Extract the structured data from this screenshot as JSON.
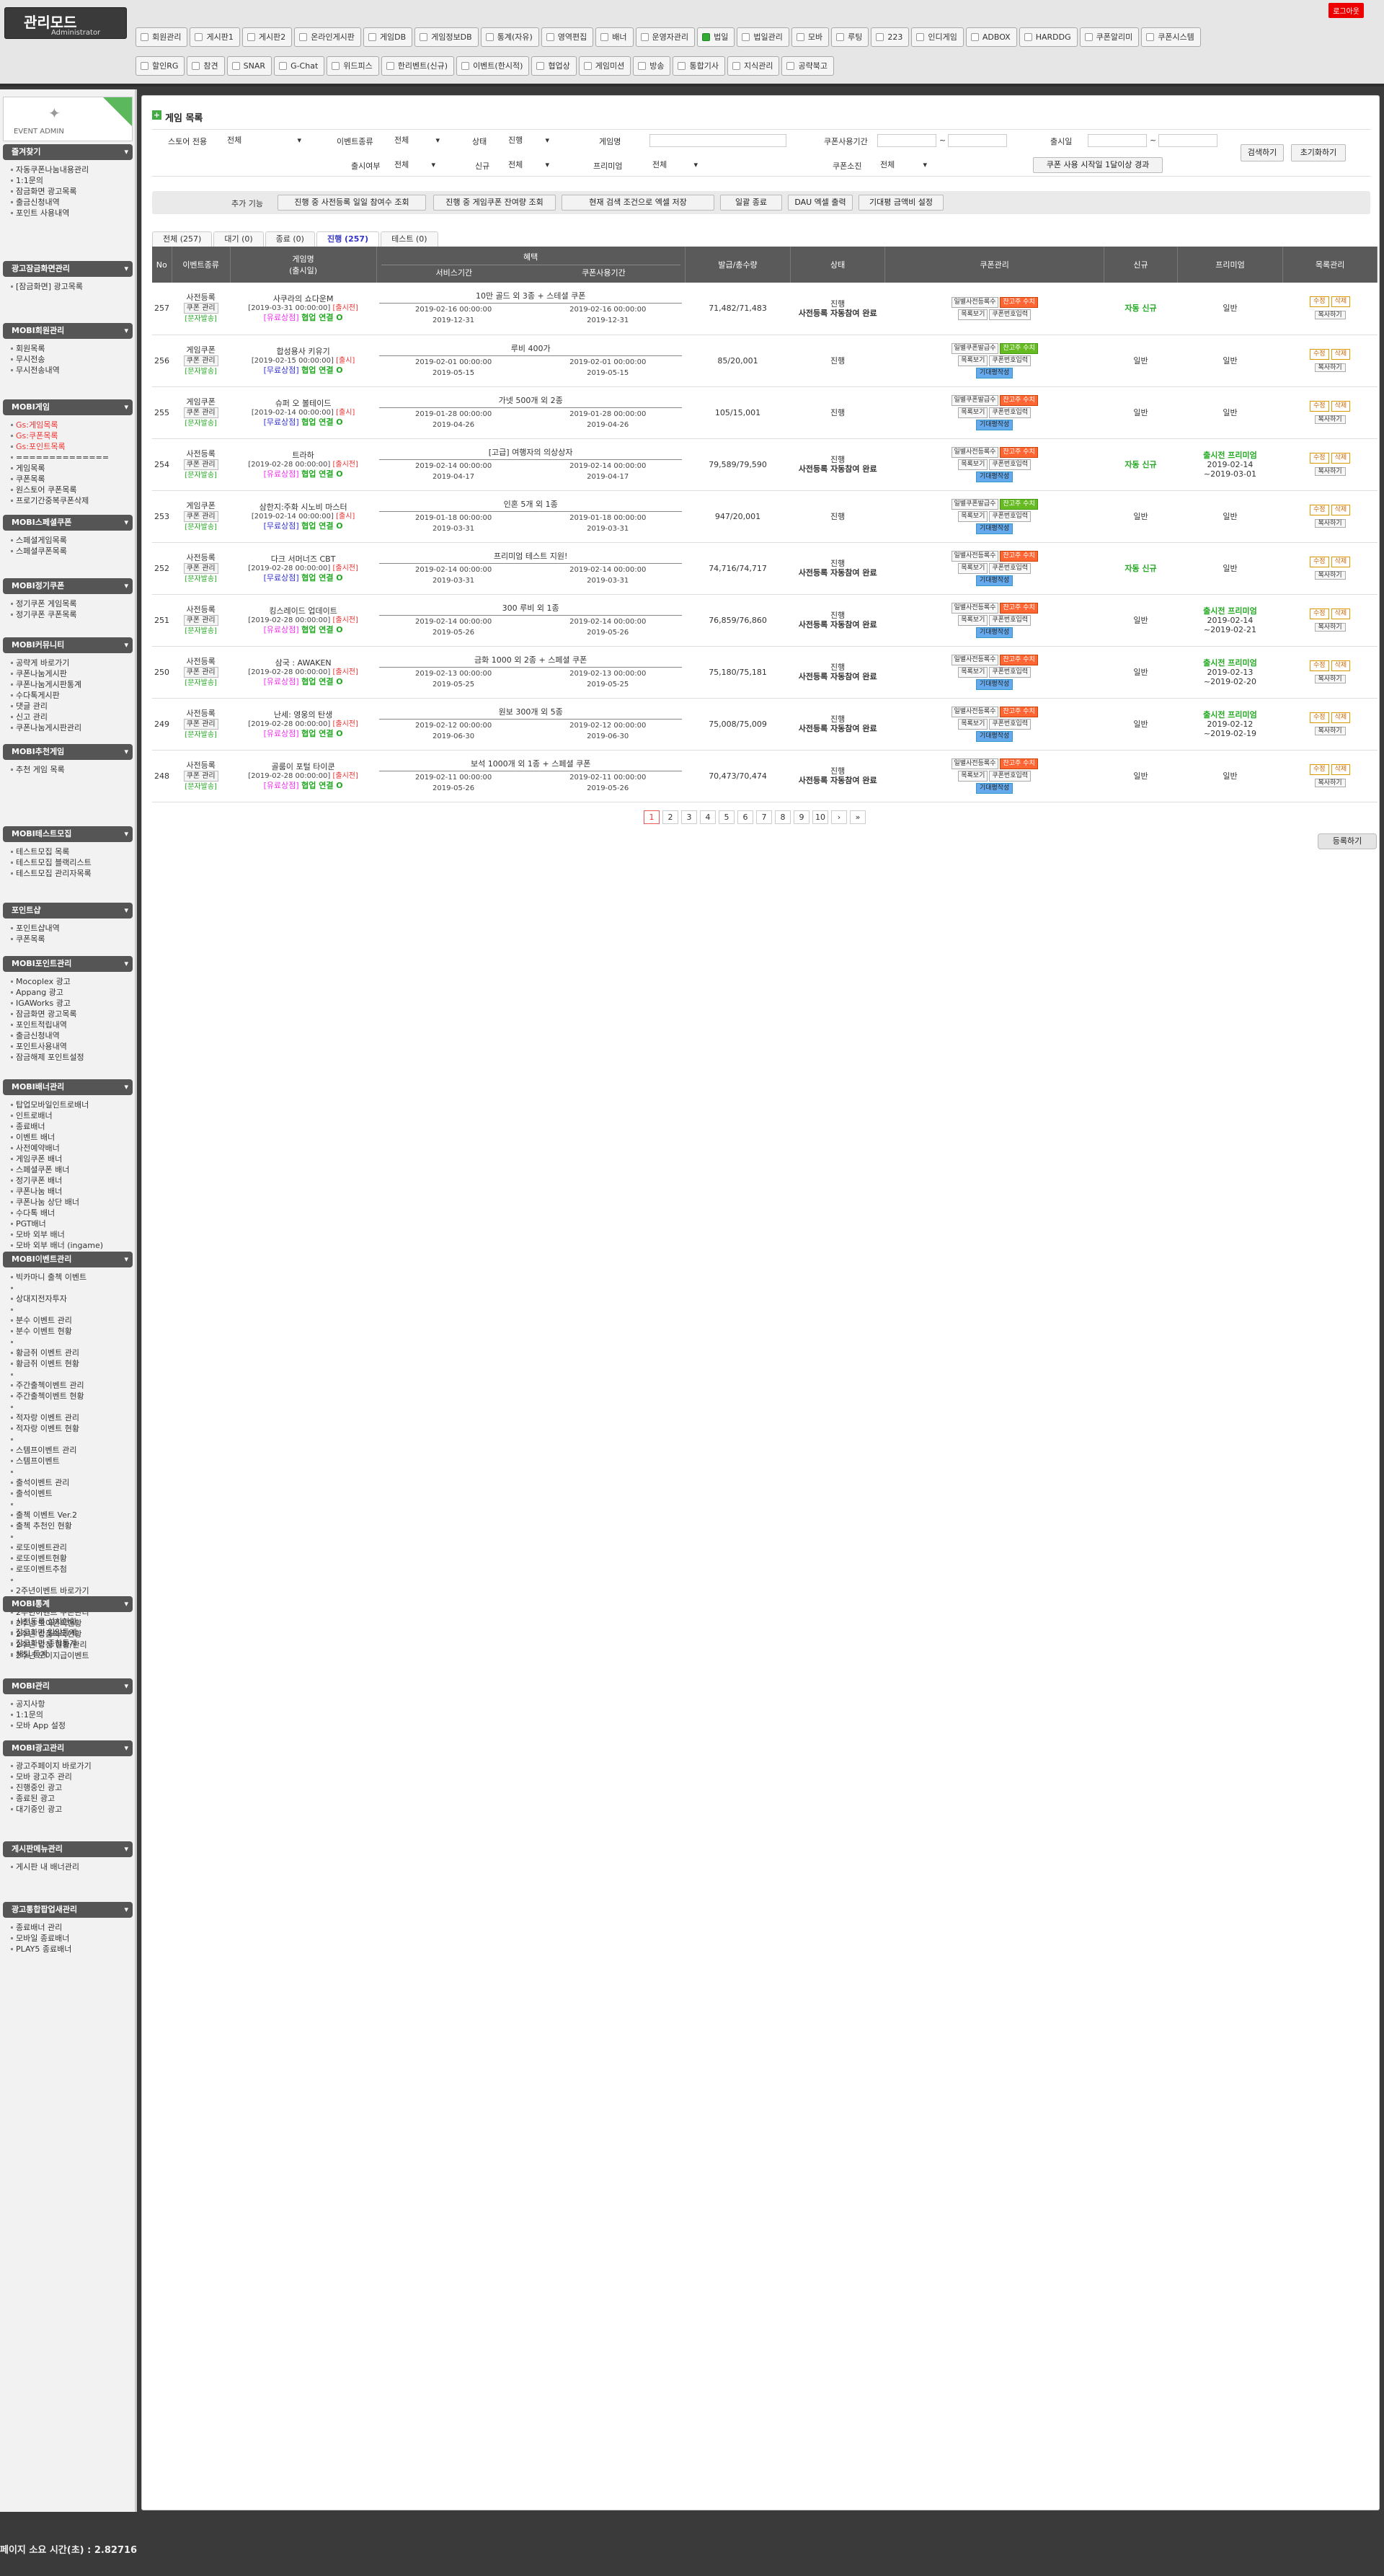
{
  "header": {
    "logo_title": "관리모드",
    "logo_sub": "Administrator",
    "logout": "로그아웃"
  },
  "menu_row1": [
    "회원관리",
    "게시판1",
    "게시판2",
    "온라인게시판",
    "게임DB",
    "게임정보DB",
    "통계(자유)",
    "영역편집",
    "배너",
    "운영자관리",
    "법일",
    "법일관리",
    "모바",
    "루팅",
    "223",
    "인디게임",
    "ADBOX",
    "HARDDG",
    "쿠폰알리미",
    "쿠폰시스템"
  ],
  "menu_row1_active": 10,
  "menu_row2": [
    "할인RG",
    "참견",
    "SNAR",
    "G-Chat",
    "위드피스",
    "한리벤트(신규)",
    "이벤트(한시적)",
    "협업상",
    "게임미션",
    "방송",
    "통합기사",
    "지식관리",
    "공략북고"
  ],
  "sidebar": {
    "event_label": "EVENT ADMIN",
    "sections": [
      {
        "title": "즐겨찾기",
        "items": [
          "자동쿠폰나눔내용관리",
          "1:1문의",
          "잠금화면 광고목록",
          "출금신청내역",
          "포인트 사용내역"
        ],
        "red": []
      },
      {
        "title": "광고잠금화면관리",
        "items": [
          "[잠금화면] 광고목록"
        ],
        "red": []
      },
      {
        "title": "MOBI회원관리",
        "items": [
          "회원목록",
          "무시전송",
          "무시전송내역"
        ],
        "red": []
      },
      {
        "title": "MOBI게임",
        "items": [
          "Gs:게임목록",
          "Gs:쿠폰목록",
          "Gs:포인트목록",
          "==============",
          "게임목록",
          "쿠폰목록",
          "원스토어 쿠폰목록",
          "프로기간중복쿠폰삭제"
        ],
        "red": [
          0,
          1,
          2
        ]
      },
      {
        "title": "MOBI스페셜쿠폰",
        "items": [
          "스페셜게임목록",
          "스페셜쿠폰목록"
        ],
        "red": []
      },
      {
        "title": "MOBI정기쿠폰",
        "items": [
          "정기쿠폰 게임목록",
          "정기쿠폰 쿠폰목록"
        ],
        "red": []
      },
      {
        "title": "MOBI커뮤니티",
        "items": [
          "공략게 바로가기",
          "쿠폰나눔게시판",
          "쿠폰나눔게시판통계",
          "수다톡게시판",
          "댓글 관리",
          "신고 관리",
          "쿠폰나눔게시판관리"
        ],
        "red": []
      },
      {
        "title": "MOBI추천게임",
        "items": [
          "추천 게임 목록"
        ],
        "red": []
      },
      {
        "title": "MOBI테스트모집",
        "items": [
          "테스트모집 목록",
          "테스트모집 블랙리스트",
          "테스트모집 관리자목록"
        ],
        "red": []
      },
      {
        "title": "포인트샵",
        "items": [
          "포인트샵내역",
          "쿠폰목록"
        ],
        "red": []
      },
      {
        "title": "MOBI포인트관리",
        "items": [
          "Mocoplex 광고",
          "Appang 광고",
          "IGAWorks 광고",
          "잠금화면 광고목록",
          "포인트적립내역",
          "출금신청내역",
          "포인트사용내역",
          "잠금해제 포인트설정"
        ],
        "red": []
      },
      {
        "title": "MOBI배너관리",
        "items": [
          "탑업모바일인트로배너",
          "인트로배너",
          "종료배너",
          "이벤트 배너",
          "사전예약배너",
          "게임쿠폰 배너",
          "스페셜쿠폰 배너",
          "정기쿠폰 배너",
          "쿠폰나눔 배너",
          "쿠폰나눔 상단 배너",
          "수다톡 배너",
          "PGT배너",
          "모바 외부 배너",
          "모바 외부 배너 (ingame)"
        ],
        "red": []
      },
      {
        "title": "MOBI이벤트관리",
        "items": [
          "빅카마니 출첵 이벤트",
          "",
          "상대지전자투자",
          "",
          "분수 이벤트 관리",
          "분수 이벤트 현황",
          "",
          "황금쥐 이벤트 관리",
          "황금쥐 이벤트 현황",
          "",
          "주간출첵이벤트 관리",
          "주간출첵이벤트 현황",
          "",
          "적자랑 이벤트 관리",
          "적자랑 이벤트 현황",
          "",
          "스템프이벤트 관리",
          "스템프이벤트",
          "",
          "출석이벤트 관리",
          "출석이벤트",
          "",
          "출첵 이벤트 Ver.2",
          "출첵 추천인 현황",
          "",
          "로또이벤트관리",
          "로또이벤트현황",
          "로또이벤트추첨",
          "",
          "2주년이벤트 바로가기",
          "2주년이벤트 게임관리",
          "2주년이벤트 쿠폰관리",
          "2주년 모이원획현황",
          "2주년 상품획득현황",
          "2주년 당첨 현황/관리",
          "2주년 모이지급이벤트"
        ],
        "red": []
      },
      {
        "title": "MOBI통계",
        "items": [
          "사전등록 설치현황",
          "잠금화면 일일통계",
          "잠금화면 종합통계",
          "채팅 통계"
        ],
        "red": []
      },
      {
        "title": "MOBI관리",
        "items": [
          "공지사항",
          "1:1문의",
          "모바 App 설정"
        ],
        "red": []
      },
      {
        "title": "MOBI광고관리",
        "items": [
          "광고주페이지 바로가기",
          "모바 광고주 관리",
          "진행중인 광고",
          "종료된 광고",
          "대기중인 광고"
        ],
        "red": []
      },
      {
        "title": "게시판메뉴관리",
        "items": [
          "게시판 내 배너관리"
        ],
        "red": []
      },
      {
        "title": "광고통합팝업새관리",
        "items": [
          "종료배너 관리",
          "모바일 종료배너",
          "PLAY5 종료배너"
        ],
        "red": []
      }
    ]
  },
  "main": {
    "title": "게임 목록",
    "filters": {
      "store_label": "스토어 전용",
      "store_value": "전체",
      "event_type_label": "이벤트종류",
      "event_type_value": "전체",
      "status_label": "상태",
      "status_value": "진행",
      "game_name_label": "게임명",
      "game_name_value": "",
      "coupon_period_label": "쿠폰사용기간",
      "coupon_from": "",
      "coupon_to": "",
      "tilde": "~",
      "release_label": "출시일",
      "release_from": "",
      "release_to": "",
      "released_label": "출시여부",
      "released_value": "전체",
      "new_label": "신규",
      "new_value": "전체",
      "premium_label": "프리미엄",
      "premium_value": "전체",
      "coupon_src_label": "쿠폰소진",
      "coupon_src_value": "전체",
      "coupon_use_btn": "쿠폰 사용 시작일 1달이상 경과",
      "search_btn": "검색하기",
      "reset_btn": "초기화하기"
    },
    "func_label": "추가 기능",
    "func_buttons": [
      "진행 중 사전등록 일일 참여수 조회",
      "진행 중 게임쿠폰 잔여량 조회",
      "현재 검색 조건으로 엑셀 저장",
      "일괄 종료",
      "DAU 엑셀 출력",
      "기대평 금액비 설정"
    ],
    "tabs": [
      "전체 (257)",
      "대기 (0)",
      "종료 (0)",
      "진행 (257)",
      "테스트 (0)"
    ],
    "active_tab": 3,
    "columns": {
      "no": "No",
      "type": "이벤트종류",
      "name": "게임명",
      "name_sub": "(출시일)",
      "benefit": "혜택",
      "service_period": "서비스기간",
      "coupon_period": "쿠폰사용기간",
      "issued": "발급/총수량",
      "status": "상태",
      "coupon_manage": "쿠폰관리",
      "new": "신규",
      "premium": "프리미엄",
      "list_manage": "목록관리"
    },
    "row_labels": {
      "coupon_manage_link": "쿠폰 관리",
      "sms": "[문자발송]",
      "manual_reg": "일별사전등록수",
      "gift_coupon": "일별쿠폰발급수",
      "coupon_count": "잔고주 수치",
      "list_view": "목록보기",
      "coupon_no_input": "쿠폰번호입력",
      "expect": "기대평작성",
      "edit": "수정",
      "delete": "삭제",
      "copy": "복사하기",
      "action_link": "협업 연결 O"
    },
    "rows": [
      {
        "no": "257",
        "type": "사전등록",
        "name": "사쿠라의 쇼다운M",
        "date": "[2019-03-31 00:00:00]",
        "release": "[출시전]",
        "sub": "[유료상점]",
        "sub_color": "pink",
        "benefit": "10만 골드 외 3종 + 스테셜 쿠폰",
        "svc_from": "2019-02-16 00:00:00",
        "svc_to": "2019-12-31",
        "cp_from": "2019-02-16 00:00:00",
        "cp_to": "2019-12-31",
        "issued": "71,482/71,483",
        "status1": "진행",
        "status2": "사전등록 자동참여 완료",
        "cnt_color": "o",
        "expect": false,
        "new": "자동 신규",
        "new_auto": true,
        "prem": "일반",
        "prem_green": false,
        "prem2": "",
        "prem3": ""
      },
      {
        "no": "256",
        "type": "게임쿠폰",
        "name": "합성용사 키유기",
        "date": "[2019-02-15 00:00:00]",
        "release": "[출시]",
        "sub": "[무료상점]",
        "sub_color": "blue",
        "benefit": "루비 400가",
        "svc_from": "2019-02-01 00:00:00",
        "svc_to": "2019-05-15",
        "cp_from": "2019-02-01 00:00:00",
        "cp_to": "2019-05-15",
        "issued": "85/20,001",
        "status1": "진행",
        "status2": "",
        "cnt_color": "g",
        "expect": true,
        "new": "일반",
        "new_auto": false,
        "prem": "일반",
        "prem_green": false,
        "prem2": "",
        "prem3": ""
      },
      {
        "no": "255",
        "type": "게임쿠폰",
        "name": "슈퍼 오 볼테이드",
        "date": "[2019-02-14 00:00:00]",
        "release": "[출시]",
        "sub": "[무료상점]",
        "sub_color": "blue",
        "benefit": "가넷 500개 외 2종",
        "svc_from": "2019-01-28 00:00:00",
        "svc_to": "2019-04-26",
        "cp_from": "2019-01-28 00:00:00",
        "cp_to": "2019-04-26",
        "issued": "105/15,001",
        "status1": "진행",
        "status2": "",
        "cnt_color": "o",
        "expect": true,
        "new": "일반",
        "new_auto": false,
        "prem": "일반",
        "prem_green": false,
        "prem2": "",
        "prem3": ""
      },
      {
        "no": "254",
        "type": "사전등록",
        "name": "트라하",
        "date": "[2019-02-28 00:00:00]",
        "release": "[출시전]",
        "sub": "[유료상점]",
        "sub_color": "pink",
        "benefit": "[고급] 여행자의 의상상자",
        "svc_from": "2019-02-14 00:00:00",
        "svc_to": "2019-04-17",
        "cp_from": "2019-02-14 00:00:00",
        "cp_to": "2019-04-17",
        "issued": "79,589/79,590",
        "status1": "진행",
        "status2": "사전등록 자동참여 완료",
        "cnt_color": "o",
        "expect": true,
        "new": "자동 신규",
        "new_auto": true,
        "prem": "출시전 프리미엄",
        "prem_green": true,
        "prem2": "2019-02-14",
        "prem3": "~2019-03-01"
      },
      {
        "no": "253",
        "type": "게임쿠폰",
        "name": "삼한지:주화 시노비 마스터",
        "date": "[2019-02-14 00:00:00]",
        "release": "[출시]",
        "sub": "[무료상점]",
        "sub_color": "blue",
        "benefit": "인혼 5개 외 1종",
        "svc_from": "2019-01-18 00:00:00",
        "svc_to": "2019-03-31",
        "cp_from": "2019-01-18 00:00:00",
        "cp_to": "2019-03-31",
        "issued": "947/20,001",
        "status1": "진행",
        "status2": "",
        "cnt_color": "g",
        "expect": true,
        "new": "일반",
        "new_auto": false,
        "prem": "일반",
        "prem_green": false,
        "prem2": "",
        "prem3": ""
      },
      {
        "no": "252",
        "type": "사전등록",
        "name": "다크 서머너즈 CBT",
        "date": "[2019-02-28 00:00:00]",
        "release": "[출시전]",
        "sub": "[무료상점]",
        "sub_color": "blue",
        "benefit": "프리미엄 테스트 지원!",
        "svc_from": "2019-02-14 00:00:00",
        "svc_to": "2019-03-31",
        "cp_from": "2019-02-14 00:00:00",
        "cp_to": "2019-03-31",
        "issued": "74,716/74,717",
        "status1": "진행",
        "status2": "사전등록 자동참여 완료",
        "cnt_color": "o",
        "expect": true,
        "new": "자동 신규",
        "new_auto": true,
        "prem": "일반",
        "prem_green": false,
        "prem2": "",
        "prem3": ""
      },
      {
        "no": "251",
        "type": "사전등록",
        "name": "킹스레이드 업데이트",
        "date": "[2019-02-28 00:00:00]",
        "release": "[출시전]",
        "sub": "[유료상점]",
        "sub_color": "pink",
        "benefit": "300 루비 외 1종",
        "svc_from": "2019-02-14 00:00:00",
        "svc_to": "2019-05-26",
        "cp_from": "2019-02-14 00:00:00",
        "cp_to": "2019-05-26",
        "issued": "76,859/76,860",
        "status1": "진행",
        "status2": "사전등록 자동참여 완료",
        "cnt_color": "o",
        "expect": true,
        "new": "일반",
        "new_auto": false,
        "prem": "출시전 프리미엄",
        "prem_green": true,
        "prem2": "2019-02-14",
        "prem3": "~2019-02-21"
      },
      {
        "no": "250",
        "type": "사전등록",
        "name": "삼국 : AWAKEN",
        "date": "[2019-02-28 00:00:00]",
        "release": "[출시전]",
        "sub": "[유료상점]",
        "sub_color": "pink",
        "benefit": "금화 1000 외 2종 + 스페셜 쿠폰",
        "svc_from": "2019-02-13 00:00:00",
        "svc_to": "2019-05-25",
        "cp_from": "2019-02-13 00:00:00",
        "cp_to": "2019-05-25",
        "issued": "75,180/75,181",
        "status1": "진행",
        "status2": "사전등록 자동참여 완료",
        "cnt_color": "o",
        "expect": true,
        "new": "일반",
        "new_auto": false,
        "prem": "출시전 프리미엄",
        "prem_green": true,
        "prem2": "2019-02-13",
        "prem3": "~2019-02-20"
      },
      {
        "no": "249",
        "type": "사전등록",
        "name": "난세: 영웅의 탄생",
        "date": "[2019-02-28 00:00:00]",
        "release": "[출시전]",
        "sub": "[유료상점]",
        "sub_color": "pink",
        "benefit": "원보 300개 외 5종",
        "svc_from": "2019-02-12 00:00:00",
        "svc_to": "2019-06-30",
        "cp_from": "2019-02-12 00:00:00",
        "cp_to": "2019-06-30",
        "issued": "75,008/75,009",
        "status1": "진행",
        "status2": "사전등록 자동참여 완료",
        "cnt_color": "o",
        "expect": true,
        "new": "일반",
        "new_auto": false,
        "prem": "출시전 프리미엄",
        "prem_green": true,
        "prem2": "2019-02-12",
        "prem3": "~2019-02-19"
      },
      {
        "no": "248",
        "type": "사전등록",
        "name": "골룸이 포털 타이쿤",
        "date": "[2019-02-28 00:00:00]",
        "release": "[출시전]",
        "sub": "[유료상점]",
        "sub_color": "pink",
        "benefit": "보석 1000개 외 1종 + 스페셜 쿠폰",
        "svc_from": "2019-02-11 00:00:00",
        "svc_to": "2019-05-26",
        "cp_from": "2019-02-11 00:00:00",
        "cp_to": "2019-05-26",
        "issued": "70,473/70,474",
        "status1": "진행",
        "status2": "사전등록 자동참여 완료",
        "cnt_color": "o",
        "expect": true,
        "new": "일반",
        "new_auto": false,
        "prem": "일반",
        "prem_green": false,
        "prem2": "",
        "prem3": ""
      }
    ],
    "pager": [
      "1",
      "2",
      "3",
      "4",
      "5",
      "6",
      "7",
      "8",
      "9",
      "10",
      "›",
      "»"
    ],
    "register_btn": "등록하기"
  },
  "footer": "페이지 소요 시간(초) : 2.82716"
}
